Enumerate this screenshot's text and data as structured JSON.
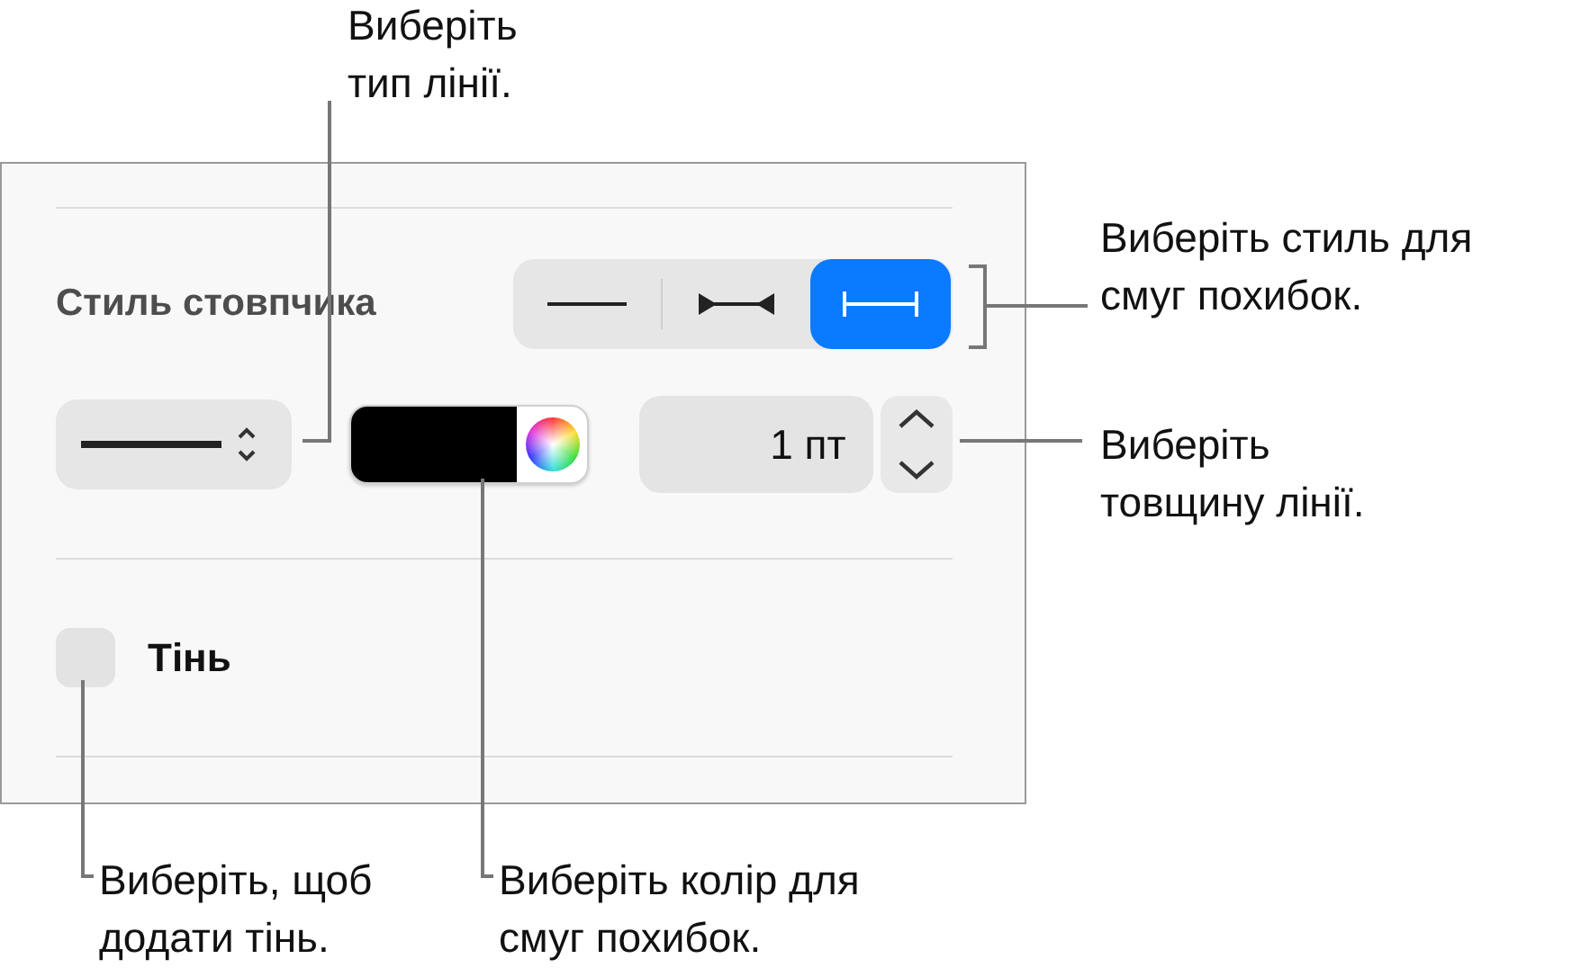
{
  "panel": {
    "bar_style": {
      "label": "Стиль стовпчика",
      "segments": [
        {
          "kind": "line",
          "selected": false
        },
        {
          "kind": "arrows",
          "selected": false
        },
        {
          "kind": "caps",
          "selected": true
        }
      ]
    },
    "line_width": {
      "value": "1 пт"
    },
    "shadow": {
      "label": "Тінь",
      "checked": false
    }
  },
  "callouts": [
    {
      "kind": "line-type",
      "text": "Виберіть\nтип лінії."
    },
    {
      "kind": "bar-style",
      "text": "Виберіть стиль для\nсмуг похибок."
    },
    {
      "kind": "thickness",
      "text": "Виберіть\nтовщину лінії."
    },
    {
      "kind": "shadow",
      "text": "Виберіть, щоб\nдодати тінь."
    },
    {
      "kind": "color",
      "text": "Виберіть колір для\nсмуг похибок."
    }
  ]
}
